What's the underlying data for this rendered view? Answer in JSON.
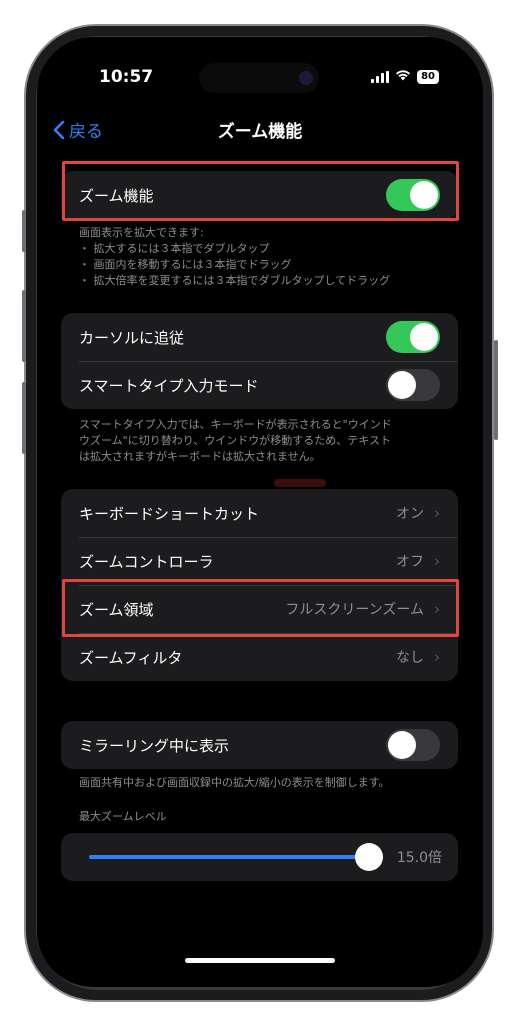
{
  "status": {
    "time": "10:57",
    "battery": "80"
  },
  "nav": {
    "back": "戻る",
    "title": "ズーム機能"
  },
  "zoom": {
    "label": "ズーム機能",
    "on": true,
    "notes": [
      "画面表示を拡大できます:",
      "・ 拡大するには３本指でダブルタップ",
      "・ 画面内を移動するには３本指でドラッグ",
      "・ 拡大倍率を変更するには３本指でダブルタップしてドラッグ"
    ]
  },
  "cursor_group": {
    "follow_cursor": {
      "label": "カーソルに追従",
      "on": true
    },
    "smart_typing": {
      "label": "スマートタイプ入力モード",
      "on": false
    },
    "notes": [
      "スマートタイプ入力では、キーボードが表示されると\"ウインド",
      "ウズーム\"に切り替わり、ウインドウが移動するため、テキスト",
      "は拡大されますがキーボードは拡大されません。"
    ]
  },
  "settings": [
    {
      "label": "キーボードショートカット",
      "value": "オン"
    },
    {
      "label": "ズームコントローラ",
      "value": "オフ"
    },
    {
      "label": "ズーム領域",
      "value": "フルスクリーンズーム"
    },
    {
      "label": "ズームフィルタ",
      "value": "なし"
    }
  ],
  "mirroring": {
    "label": "ミラーリング中に表示",
    "on": false,
    "note": "画面共有中および画面収録中の拡大/縮小の表示を制御します。"
  },
  "max_zoom": {
    "header": "最大ズームレベル",
    "value": "15.0倍",
    "fraction": 0.93
  },
  "colors": {
    "accent": "#2f7ff6",
    "toggle_on": "#34c759",
    "highlight": "#e0463d"
  }
}
